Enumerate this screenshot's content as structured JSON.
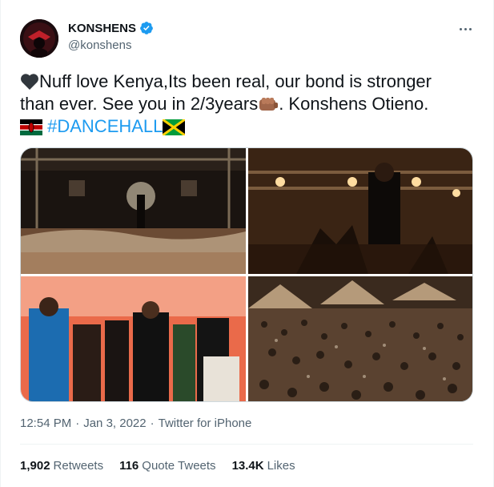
{
  "author": {
    "display_name": "KONSHENS",
    "handle": "@konshens",
    "verified": true,
    "avatar_icon": "avatar-image"
  },
  "tweet": {
    "line1": "Nuff love Kenya,Its been real, our bond is stronger",
    "line2_a": "than ever. See you in 2/3years",
    "line2_b": ".   Konshens Otieno.",
    "hashtag": "#DANCEHALL",
    "emojis": [
      "black-heart",
      "fist-bump",
      "kenya-flag",
      "jamaica-flag"
    ]
  },
  "media": {
    "count": 4,
    "items": [
      "stage-performance-wide",
      "stage-performance-closeup",
      "group-photo",
      "crowd-photo"
    ]
  },
  "meta": {
    "time": "12:54 PM",
    "separator": "·",
    "date": "Jan 3, 2022",
    "source": "Twitter for iPhone"
  },
  "stats": {
    "retweets_count": "1,902",
    "retweets_label": "Retweets",
    "quotes_count": "116",
    "quotes_label": "Quote Tweets",
    "likes_count": "13.4K",
    "likes_label": "Likes"
  },
  "colors": {
    "link": "#1d9bf0",
    "secondary_text": "#536471",
    "verified": "#1d9bf0"
  }
}
